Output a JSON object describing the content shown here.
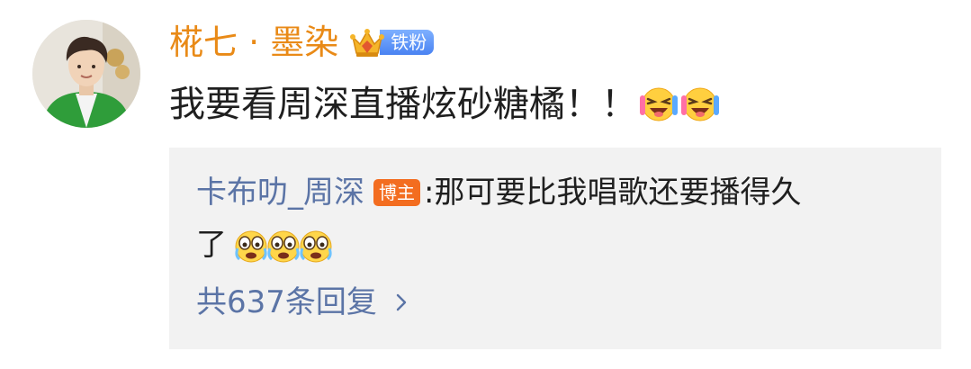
{
  "comment": {
    "username": "椛七 · 墨染",
    "fan_badge": {
      "label": "铁粉",
      "icon": "crown-icon",
      "color": "#4a83f2"
    },
    "text": "我要看周深直播炫砂糖橘！！",
    "emojis": [
      "laughing-tears-emoji",
      "laughing-tears-emoji"
    ],
    "username_color": "#e98a17"
  },
  "reply": {
    "author": "卡布叻_周深",
    "author_badge": "博主",
    "separator": ":",
    "text_line1": "那可要比我唱歌还要播得久",
    "text_line2": "了",
    "emojis": [
      "crying-laugh-emoji",
      "crying-laugh-emoji",
      "crying-laugh-emoji"
    ],
    "more_replies": "共637条回复",
    "more_icon": "chevron-right-icon",
    "link_color": "#5b74a6"
  }
}
